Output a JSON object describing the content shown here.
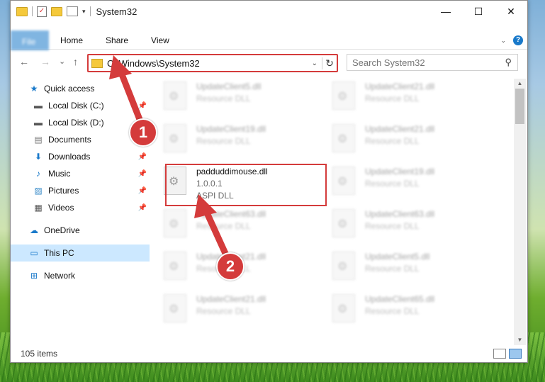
{
  "window": {
    "title": "System32"
  },
  "ribbon": {
    "tabs": [
      {
        "label": "File"
      },
      {
        "label": "Home"
      },
      {
        "label": "Share"
      },
      {
        "label": "View"
      }
    ],
    "help": "?"
  },
  "window_controls": {
    "minimize": "—",
    "maximize": "☐",
    "close": "✕"
  },
  "navigation": {
    "back": "←",
    "forward": "→",
    "recent": "⌄",
    "up": "↑"
  },
  "address": {
    "path": "C:\\Windows\\System32",
    "dropdown": "⌄",
    "refresh": "↻"
  },
  "search": {
    "placeholder": "Search System32"
  },
  "sidebar": {
    "items": [
      {
        "label": "Quick access",
        "icon": "star-icon"
      },
      {
        "label": "Local Disk (C:)",
        "icon": "drive-icon"
      },
      {
        "label": "Local Disk (D:)",
        "icon": "drive-icon"
      },
      {
        "label": "Documents",
        "icon": "documents-icon"
      },
      {
        "label": "Downloads",
        "icon": "download-icon"
      },
      {
        "label": "Music",
        "icon": "music-icon"
      },
      {
        "label": "Pictures",
        "icon": "pictures-icon"
      },
      {
        "label": "Videos",
        "icon": "videos-icon"
      },
      {
        "label": "OneDrive",
        "icon": "cloud-icon"
      },
      {
        "label": "This PC",
        "icon": "computer-icon"
      },
      {
        "label": "Network",
        "icon": "network-icon"
      }
    ]
  },
  "files": [
    {
      "name": "UpdateClient5.dll",
      "line2": "Resource DLL"
    },
    {
      "name": "UpdateClient21.dll",
      "line2": "Resource DLL"
    },
    {
      "name": "UpdateClient19.dll",
      "line2": "Resource DLL"
    },
    {
      "name": "UpdateClient21.dll",
      "line2": "Resource DLL"
    },
    {
      "name": "padduddimouse.dll",
      "line2": "1.0.0.1",
      "line3": "ASPI DLL",
      "highlighted": true
    },
    {
      "name": "UpdateClient19.dll",
      "line2": "Resource DLL"
    },
    {
      "name": "UpdateClient63.dll",
      "line2": "Resource DLL"
    },
    {
      "name": "UpdateClient63.dll",
      "line2": "Resource DLL"
    },
    {
      "name": "UpdateClient21.dll",
      "line2": "Resource DLL"
    },
    {
      "name": "UpdateClient5.dll",
      "line2": "Resource DLL"
    },
    {
      "name": "UpdateClient21.dll",
      "line2": "Resource DLL"
    },
    {
      "name": "UpdateClient65.dll",
      "line2": "Resource DLL"
    }
  ],
  "status": {
    "item_count": "105 items"
  },
  "annotations": {
    "step1": "1",
    "step2": "2",
    "color": "#d43b3b"
  }
}
